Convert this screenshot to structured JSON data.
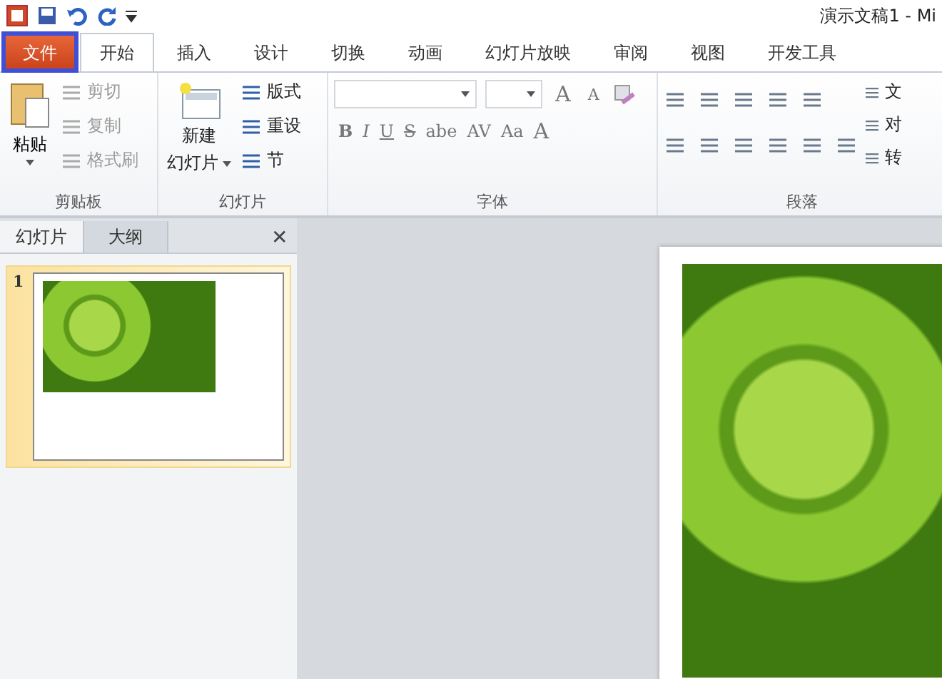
{
  "title_bar": {
    "title": "演示文稿1 - Mi"
  },
  "tabs": [
    {
      "label": "文件",
      "kind": "file",
      "selected": false,
      "highlighted": true
    },
    {
      "label": "开始",
      "kind": "tab",
      "selected": true,
      "highlighted": false
    },
    {
      "label": "插入",
      "kind": "tab",
      "selected": false,
      "highlighted": false
    },
    {
      "label": "设计",
      "kind": "tab",
      "selected": false,
      "highlighted": false
    },
    {
      "label": "切换",
      "kind": "tab",
      "selected": false,
      "highlighted": false
    },
    {
      "label": "动画",
      "kind": "tab",
      "selected": false,
      "highlighted": false
    },
    {
      "label": "幻灯片放映",
      "kind": "tab",
      "selected": false,
      "highlighted": false
    },
    {
      "label": "审阅",
      "kind": "tab",
      "selected": false,
      "highlighted": false
    },
    {
      "label": "视图",
      "kind": "tab",
      "selected": false,
      "highlighted": false
    },
    {
      "label": "开发工具",
      "kind": "tab",
      "selected": false,
      "highlighted": false
    }
  ],
  "ribbon": {
    "clipboard": {
      "label": "剪贴板",
      "paste": "粘贴",
      "items": [
        {
          "label": "剪切",
          "disabled": true
        },
        {
          "label": "复制",
          "disabled": true
        },
        {
          "label": "格式刷",
          "disabled": true
        }
      ]
    },
    "slides": {
      "label": "幻灯片",
      "new_slide": [
        "新建",
        "幻灯片"
      ],
      "items": [
        {
          "label": "版式"
        },
        {
          "label": "重设"
        },
        {
          "label": "节"
        }
      ]
    },
    "font": {
      "label": "字体",
      "grow": "A",
      "shrink": "A",
      "format_buttons": [
        "B",
        "I",
        "U",
        "S",
        "abe",
        "AV",
        "Aa"
      ],
      "font_color": "A"
    },
    "paragraph": {
      "label": "段落",
      "side_items": [
        "文",
        "对",
        "转"
      ]
    }
  },
  "panel": {
    "tabs": [
      {
        "label": "幻灯片",
        "selected": true
      },
      {
        "label": "大纲",
        "selected": false
      }
    ],
    "close": "✕",
    "slides": [
      {
        "number": "1",
        "selected": true
      }
    ]
  }
}
